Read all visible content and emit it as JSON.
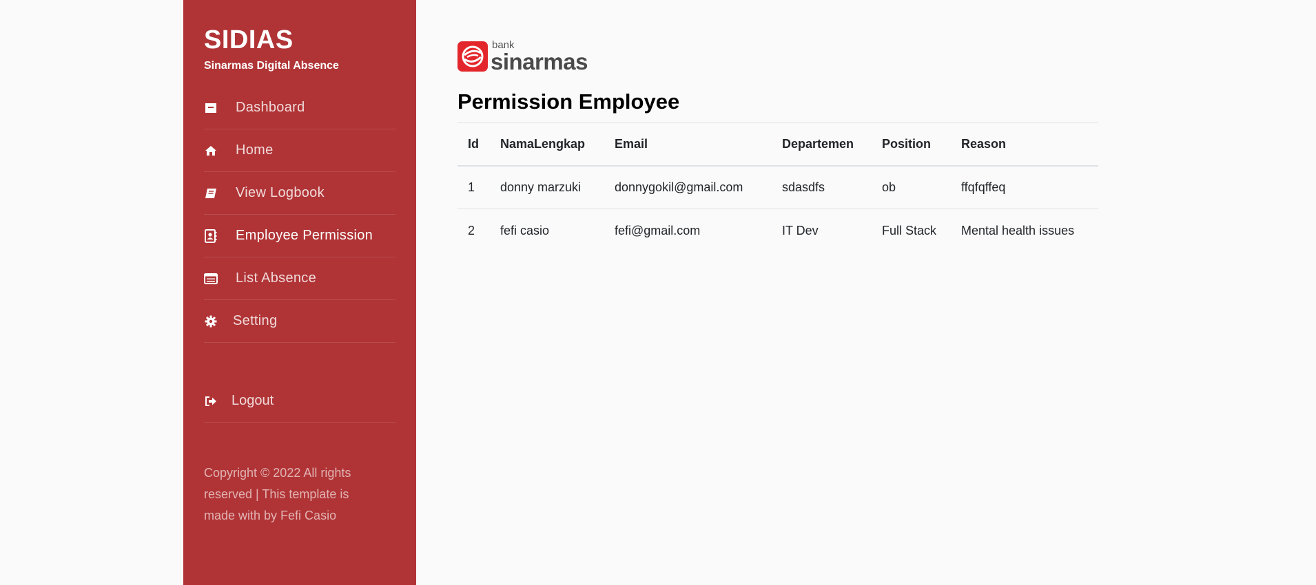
{
  "brand": {
    "title": "SIDIAS",
    "subtitle": "Sinarmas Digital Absence"
  },
  "sidebar": {
    "items": [
      {
        "label": "Dashboard",
        "icon": "dashboard-icon"
      },
      {
        "label": "Home",
        "icon": "home-icon"
      },
      {
        "label": "View Logbook",
        "icon": "book-icon"
      },
      {
        "label": "Employee Permission",
        "icon": "contact-book-icon",
        "active": true
      },
      {
        "label": "List Absence",
        "icon": "list-card-icon"
      },
      {
        "label": "Setting",
        "icon": "gear-icon"
      }
    ],
    "logout_label": "Logout",
    "copyright": "Copyright © 2022 All rights reserved | This template is made with by Fefi Casio"
  },
  "logo": {
    "small": "bank",
    "name": "sinarmas"
  },
  "main": {
    "title": "Permission Employee",
    "table": {
      "headers": [
        "Id",
        "NamaLengkap",
        "Email",
        "Departemen",
        "Position",
        "Reason"
      ],
      "rows": [
        [
          "1",
          "donny marzuki",
          "donnygokil@gmail.com",
          "sdasdfs",
          "ob",
          "ffqfqffeq"
        ],
        [
          "2",
          "fefi casio",
          "fefi@gmail.com",
          "IT Dev",
          "Full Stack",
          "Mental health issues"
        ]
      ]
    }
  },
  "colors": {
    "sidebar_bg": "#b03436",
    "logo_red": "#e3262b",
    "page_bg": "#fafafa"
  }
}
